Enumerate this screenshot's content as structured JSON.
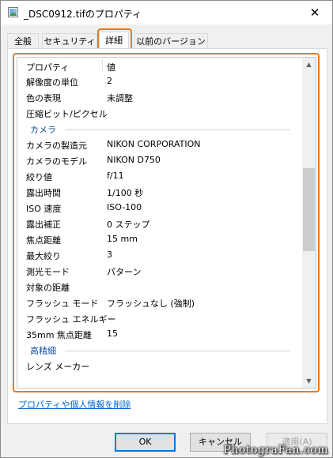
{
  "window": {
    "title": "_DSC0912.tifのプロパティ",
    "close_glyph": "✕",
    "icon": "image-file-icon"
  },
  "tabs": [
    {
      "label": "全般",
      "active": false
    },
    {
      "label": "セキュリティ",
      "active": false
    },
    {
      "label": "詳細",
      "active": true
    },
    {
      "label": "以前のバージョン",
      "active": false
    }
  ],
  "details": {
    "header": {
      "property": "プロパティ",
      "value": "値"
    },
    "rows": [
      {
        "type": "item",
        "key": "解像度の単位",
        "value": "2"
      },
      {
        "type": "item",
        "key": "色の表現",
        "value": "未調整"
      },
      {
        "type": "item",
        "key": "圧縮ビット/ピクセル",
        "value": ""
      },
      {
        "type": "group",
        "label": "カメラ"
      },
      {
        "type": "item",
        "key": "カメラの製造元",
        "value": "NIKON CORPORATION"
      },
      {
        "type": "item",
        "key": "カメラのモデル",
        "value": "NIKON D750"
      },
      {
        "type": "item",
        "key": "絞り値",
        "value": "f/11"
      },
      {
        "type": "item",
        "key": "露出時間",
        "value": "1/100 秒"
      },
      {
        "type": "item",
        "key": "ISO 速度",
        "value": "ISO-100"
      },
      {
        "type": "item",
        "key": "露出補正",
        "value": "0 ステップ"
      },
      {
        "type": "item",
        "key": "焦点距離",
        "value": "15 mm"
      },
      {
        "type": "item",
        "key": "最大絞り",
        "value": "3"
      },
      {
        "type": "item",
        "key": "測光モード",
        "value": "パターン"
      },
      {
        "type": "item",
        "key": "対象の距離",
        "value": ""
      },
      {
        "type": "item",
        "key": "フラッシュ モード",
        "value": "フラッシュなし (強制)"
      },
      {
        "type": "item",
        "key": "フラッシュ エネルギー",
        "value": ""
      },
      {
        "type": "item",
        "key": "35mm 焦点距離",
        "value": "15"
      },
      {
        "type": "group",
        "label": "高精細"
      },
      {
        "type": "item",
        "key": "レンズ メーカー",
        "value": ""
      }
    ]
  },
  "remove_link": "プロパティや個人情報を削除",
  "buttons": {
    "ok": "OK",
    "cancel": "キャンセル",
    "apply": "適用(A)"
  },
  "scrollbar": {
    "up_glyph": "▲",
    "down_glyph": "▼"
  },
  "watermark": "PhotograFan.com",
  "colors": {
    "highlight": "#e8781c",
    "link": "#0066cc",
    "group_label": "#1a4fa0",
    "default_button_border": "#0078d7"
  }
}
